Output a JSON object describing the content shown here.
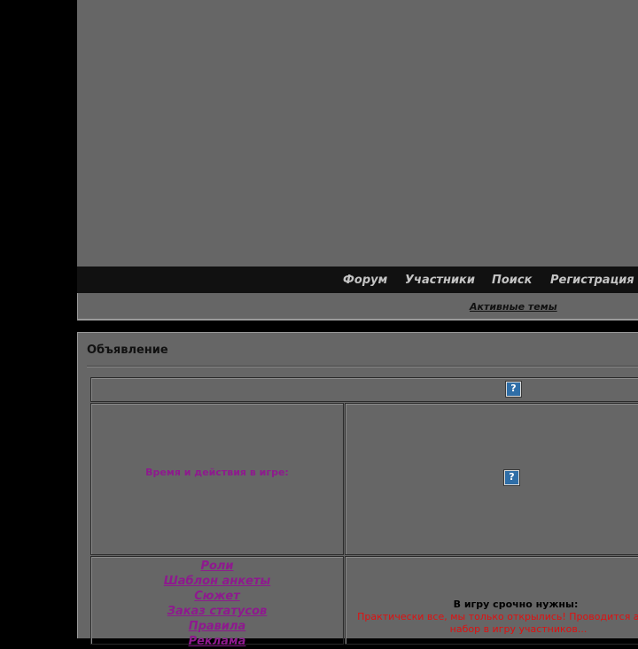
{
  "nav": {
    "items": [
      {
        "label": "Форум"
      },
      {
        "label": "Участники"
      },
      {
        "label": "Поиск"
      },
      {
        "label": "Регистрация"
      }
    ]
  },
  "subnav": {
    "active_topics": "Активные темы"
  },
  "announcement": {
    "title": "Объявление",
    "time_label": "Время и действия в игре:",
    "menu": [
      {
        "label": "Роли"
      },
      {
        "label": "Шаблон анкеты"
      },
      {
        "label": "Сюжет"
      },
      {
        "label": "Заказ статусов"
      },
      {
        "label": "Правила"
      },
      {
        "label": "Реклама"
      }
    ],
    "urgent_title": "В игру срочно нужны:",
    "urgent_text": "Практически все, мы только открылись! Проводится акция на набор в игру участников...",
    "image_placeholder": "?"
  },
  "colors": {
    "background": "#000000",
    "panel": "#666666",
    "navbar": "#111111",
    "link_purple": "#8e1a8e",
    "warning_red": "#e01010"
  },
  "icons": [
    "broken-image-icon"
  ]
}
